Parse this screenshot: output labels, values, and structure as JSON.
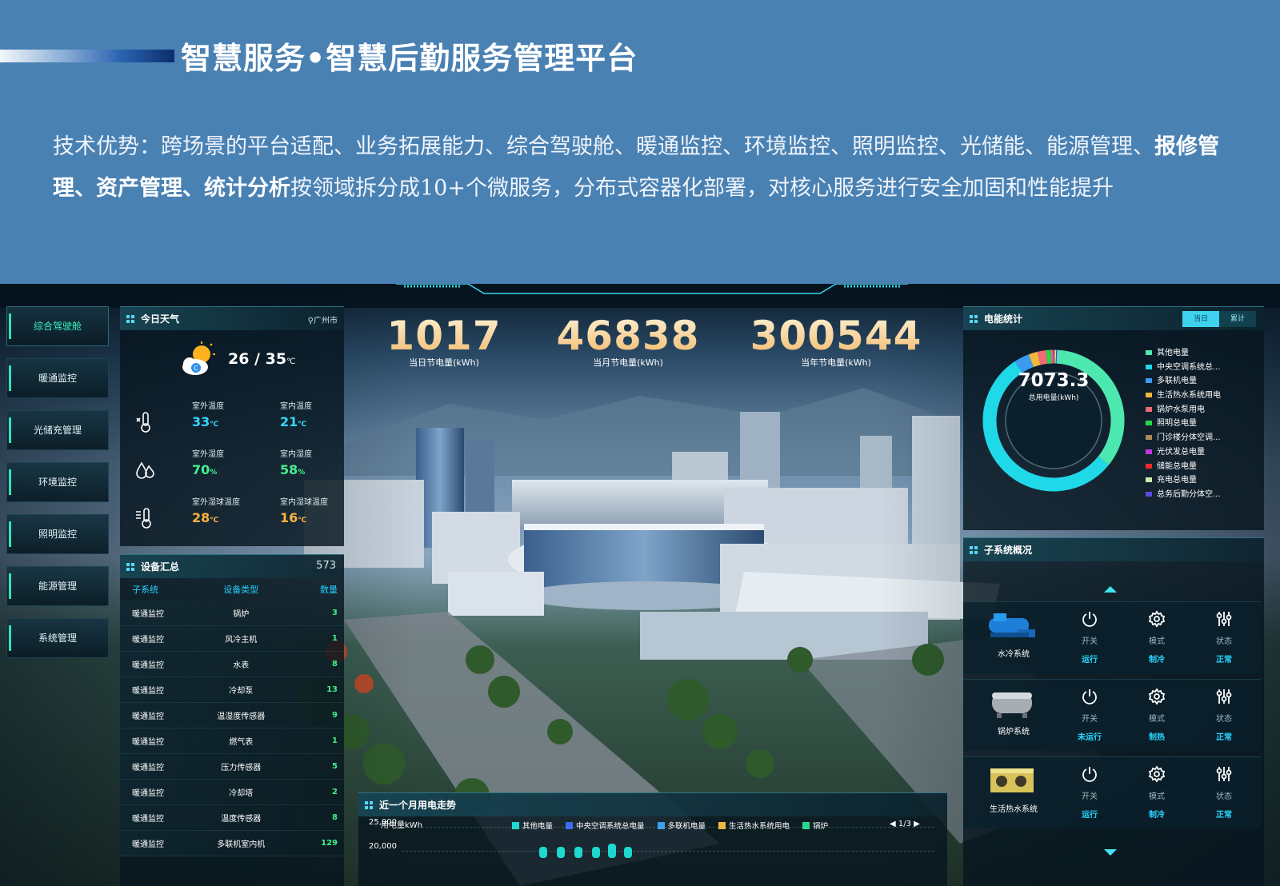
{
  "banner": {
    "title": "智慧服务•智慧后勤服务管理平台",
    "desc_part1": "技术优势：跨场景的平台适配、业务拓展能力、综合驾驶舱、暖通监控、环境监控、照明监控、光储能、能源管理、",
    "desc_bold": "报修管理、资产管理、统计分析",
    "desc_part2": "按领域拆分成10+个微服务，分布式容器化部署，对核心服务进行安全加固和性能提升"
  },
  "nav": [
    "综合驾驶舱",
    "暖通监控",
    "光储充管理",
    "环境监控",
    "照明监控",
    "能源管理",
    "系统管理"
  ],
  "weather": {
    "title": "今日天气",
    "city": "广州市",
    "temp_range": "26 / 35",
    "unit": "℃",
    "rows": [
      {
        "icon": "thermometer-icon",
        "a_label": "室外温度",
        "a_value": "33",
        "a_unit": "℃",
        "b_label": "室内温度",
        "b_value": "21",
        "b_unit": "℃",
        "a_color": "#35d7ff",
        "b_color": "#35d7ff"
      },
      {
        "icon": "humidity-icon",
        "a_label": "室外湿度",
        "a_value": "70",
        "a_unit": "%",
        "b_label": "室内湿度",
        "b_value": "58",
        "b_unit": "%",
        "a_color": "#45f08f",
        "b_color": "#45f08f"
      },
      {
        "icon": "wet-bulb-icon",
        "a_label": "室外湿球温度",
        "a_value": "28",
        "a_unit": "℃",
        "b_label": "室内湿球温度",
        "b_value": "16",
        "b_unit": "℃",
        "a_color": "#ffb23f",
        "b_color": "#ffb23f"
      }
    ]
  },
  "devices": {
    "title": "设备汇总",
    "total": "573",
    "headers": [
      "子系统",
      "设备类型",
      "数量"
    ],
    "rows": [
      [
        "暖通监控",
        "锅炉",
        "3"
      ],
      [
        "暖通监控",
        "风冷主机",
        "1"
      ],
      [
        "暖通监控",
        "水表",
        "8"
      ],
      [
        "暖通监控",
        "冷却泵",
        "13"
      ],
      [
        "暖通监控",
        "温湿度传感器",
        "9"
      ],
      [
        "暖通监控",
        "燃气表",
        "1"
      ],
      [
        "暖通监控",
        "压力传感器",
        "5"
      ],
      [
        "暖通监控",
        "冷却塔",
        "2"
      ],
      [
        "暖通监控",
        "温度传感器",
        "8"
      ],
      [
        "暖通监控",
        "多联机室内机",
        "129"
      ]
    ]
  },
  "stats": [
    {
      "value": "1017",
      "label": "当日节电量(kWh)"
    },
    {
      "value": "46838",
      "label": "当月节电量(kWh)"
    },
    {
      "value": "300544",
      "label": "当年节电量(kWh)"
    }
  ],
  "energy": {
    "title": "电能统计",
    "tab_today": "当日",
    "tab_total": "累计",
    "total": "7073.3",
    "total_label": "总用电量(kWh)",
    "legend": [
      {
        "name": "其他电量",
        "color": "#4de8b0"
      },
      {
        "name": "中央空调系统总...",
        "color": "#1fd8e8"
      },
      {
        "name": "多联机电量",
        "color": "#3a9bf0"
      },
      {
        "name": "生活热水系统用电",
        "color": "#f0b93a"
      },
      {
        "name": "锅炉水泵用电",
        "color": "#f06a7a"
      },
      {
        "name": "照明总电量",
        "color": "#27d84a"
      },
      {
        "name": "门诊楼分体空调...",
        "color": "#b08a5a"
      },
      {
        "name": "光伏发总电量",
        "color": "#c03ae0"
      },
      {
        "name": "储能总电量",
        "color": "#f02a2a"
      },
      {
        "name": "充电总电量",
        "color": "#c8f0b0"
      },
      {
        "name": "总务后勤分体空...",
        "color": "#5a4ae0"
      }
    ]
  },
  "chart_data": {
    "type": "pie",
    "categories": [
      "其他电量",
      "中央空调系统总...",
      "多联机电量",
      "生活热水系统用电",
      "锅炉水泵用电",
      "照明总电量",
      "门诊楼分体空调...",
      "光伏发总电量",
      "储能总电量",
      "充电总电量",
      "总务后勤分体空..."
    ],
    "values": [
      35,
      55,
      3.5,
      2,
      2,
      1,
      0.5,
      0.3,
      0.2,
      0.3,
      0.2
    ]
  },
  "subsystems": {
    "title": "子系统概况",
    "control_labels": [
      "开关",
      "模式",
      "状态"
    ],
    "items": [
      {
        "name": "水冷系统",
        "switch": "运行",
        "mode": "制冷",
        "state": "正常",
        "switch_color": "#29d6ff"
      },
      {
        "name": "锅炉系统",
        "switch": "未运行",
        "mode": "制热",
        "state": "正常",
        "switch_color": "#29d6ff"
      },
      {
        "name": "生活热水系统",
        "switch": "运行",
        "mode": "制冷",
        "state": "正常",
        "switch_color": "#29d6ff"
      }
    ]
  },
  "trend": {
    "title": "近一个月用电走势",
    "ylabel": "用电量kWh",
    "legend": [
      {
        "name": "其他电量",
        "color": "#1fd8d0"
      },
      {
        "name": "中央空调系统总电量",
        "color": "#3a6af0"
      },
      {
        "name": "多联机电量",
        "color": "#3aa0f0"
      },
      {
        "name": "生活热水系统用电",
        "color": "#f0b93a"
      },
      {
        "name": "锅炉",
        "color": "#27d88a"
      }
    ],
    "page": "1/3",
    "ticks": [
      "25,000",
      "20,000"
    ]
  }
}
